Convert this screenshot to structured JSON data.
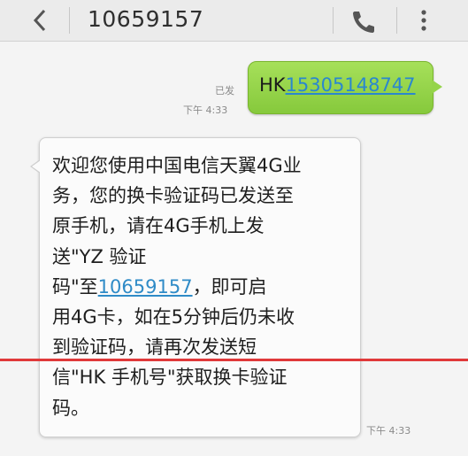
{
  "header": {
    "contact": "10659157"
  },
  "messages": [
    {
      "direction": "outgoing",
      "status": "已发",
      "time": "下午 4:33",
      "prefix": "HK",
      "link_text": "15305148747"
    },
    {
      "direction": "incoming",
      "time": "下午 4:33",
      "lines": [
        "欢迎您使用中国电信天翼4G业",
        "务，您的换卡验证码已发送至",
        "原手机，请在4G手机上发",
        "送\"YZ 验证"
      ],
      "line5_before": "码\"至",
      "line5_link": "10659157",
      "line5_after": "，即可启",
      "lines_after": [
        "用4G卡，如在5分钟后仍未收",
        "到验证码，请再次发送短",
        "信\"HK 手机号\"获取换卡验证",
        "码。"
      ]
    }
  ],
  "colors": {
    "outgoing_bubble": "#95d44a",
    "link": "#2f8bc7",
    "overlay_line": "#e0393a"
  },
  "icons": [
    "back-arrow-icon",
    "phone-icon",
    "more-vert-icon"
  ]
}
